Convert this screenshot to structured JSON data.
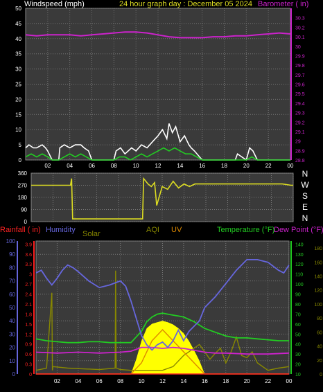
{
  "header": {
    "windspeed_label": "Windspeed (mph)",
    "title": "24 hour graph day : December 05 2024",
    "barometer_label": "Barometer ( in)"
  },
  "legend": {
    "rainfall": "Rainfall ( in)",
    "humidity": "Humidity",
    "solar": "Solar",
    "aqi": "AQI",
    "uv": "UV",
    "temperature": "Temperature (°F)",
    "dewpoint": "Dew Point (°F)"
  },
  "colors": {
    "wind_gust": "#ffffff",
    "wind_avg": "#22cc22",
    "barometer": "#cc22cc",
    "direction": "#dddd22",
    "humidity": "#6666dd",
    "solar": "#ffff00",
    "aqi": "#888800",
    "uv": "#dd8800",
    "temperature": "#22cc22",
    "dewpoint": "#cc22cc",
    "rainfall": "#ff2222"
  },
  "compass": [
    "N",
    "W",
    "S",
    "E",
    "N"
  ],
  "chart_data": [
    {
      "type": "line",
      "name": "wind",
      "ylim": [
        0,
        50
      ],
      "y_ticks": [
        "0",
        "5",
        "10",
        "15",
        "20",
        "25",
        "30",
        "35",
        "40",
        "45",
        "50"
      ],
      "x_ticks": [
        "02",
        "04",
        "06",
        "08",
        "10",
        "12",
        "14",
        "16",
        "18",
        "20",
        "22",
        "00"
      ],
      "series": [
        {
          "name": "gust",
          "x": [
            0,
            0.3,
            0.7,
            1,
            1.5,
            1.8,
            2,
            2.4,
            3,
            3.1,
            3.5,
            4,
            4.5,
            5,
            5.3,
            5.7,
            6,
            7,
            8,
            8.2,
            8.6,
            9,
            9.3,
            9.6,
            10,
            10.5,
            11,
            11.5,
            12,
            12.4,
            12.8,
            13,
            13.3,
            13.6,
            14,
            14.4,
            14.8,
            15,
            15.3,
            16,
            17,
            18,
            19,
            19.2,
            20,
            20.3,
            20.6,
            21,
            22,
            23,
            24
          ],
          "values": [
            4,
            5,
            4,
            4,
            5,
            4,
            3,
            0,
            0,
            4,
            5,
            4,
            5,
            5,
            4,
            3,
            0,
            0,
            0,
            3,
            4,
            2,
            3,
            4,
            3,
            5,
            4,
            6,
            8,
            10,
            7,
            12,
            9,
            11,
            6,
            8,
            5,
            4,
            3,
            0,
            0,
            0,
            0,
            2,
            0,
            4,
            3,
            0,
            0,
            0,
            0
          ]
        },
        {
          "name": "average",
          "x": [
            0,
            0.5,
            1,
            1.5,
            2,
            2.4,
            3,
            3.5,
            4,
            4.5,
            5,
            5.5,
            6,
            7,
            8,
            8.5,
            9,
            9.5,
            10,
            10.5,
            11,
            11.5,
            12,
            12.5,
            13,
            13.5,
            14,
            14.5,
            15,
            15.5,
            16,
            17,
            18,
            19,
            20,
            20.5,
            21,
            22,
            23,
            24
          ],
          "values": [
            1,
            2,
            1,
            2,
            1,
            0,
            0,
            1,
            2,
            1,
            2,
            1,
            0,
            0,
            0,
            1,
            1,
            0,
            1,
            2,
            1,
            2,
            3,
            4,
            3,
            4,
            3,
            2,
            2,
            1,
            0,
            0,
            0,
            0,
            0,
            1,
            0,
            0,
            0,
            0
          ]
        }
      ]
    },
    {
      "type": "line",
      "name": "barometer",
      "ylim": [
        28.8,
        30.4
      ],
      "y_ticks": [
        "28.8",
        "28.9",
        "29",
        "29.1",
        "29.2",
        "29.3",
        "29.4",
        "29.5",
        "29.6",
        "29.7",
        "29.8",
        "29.9",
        "30",
        "30.1",
        "30.2",
        "30.3"
      ],
      "x": [
        0,
        1,
        2,
        3,
        4,
        5,
        6,
        7,
        8,
        9,
        10,
        11,
        12,
        13,
        14,
        15,
        16,
        17,
        18,
        19,
        20,
        21,
        22,
        23,
        24
      ],
      "values": [
        30.12,
        30.11,
        30.12,
        30.12,
        30.12,
        30.11,
        30.12,
        30.13,
        30.14,
        30.15,
        30.15,
        30.14,
        30.12,
        30.1,
        30.09,
        30.09,
        30.09,
        30.1,
        30.1,
        30.11,
        30.11,
        30.12,
        30.13,
        30.14,
        30.13
      ]
    },
    {
      "type": "line",
      "name": "wind_direction",
      "ylim": [
        0,
        360
      ],
      "y_ticks": [
        "0",
        "90",
        "180",
        "270",
        "360"
      ],
      "x": [
        0,
        0.2,
        3.6,
        3.7,
        3.8,
        3.9,
        6,
        8,
        10.2,
        10.3,
        10.5,
        10.7,
        11,
        11.3,
        11.5,
        12,
        12.5,
        13,
        13.5,
        14,
        14.5,
        15,
        16,
        17,
        18,
        19,
        20,
        21,
        22,
        23,
        23.8,
        24
      ],
      "values": [
        270,
        270,
        270,
        320,
        20,
        20,
        20,
        20,
        20,
        320,
        300,
        280,
        260,
        290,
        120,
        260,
        240,
        300,
        250,
        280,
        260,
        280,
        280,
        280,
        280,
        280,
        280,
        280,
        280,
        280,
        270,
        270
      ]
    },
    {
      "type": "line",
      "name": "atmosphere",
      "x_ticks": [
        "02",
        "04",
        "06",
        "08",
        "10",
        "12",
        "14",
        "16",
        "18",
        "20",
        "22",
        "00"
      ],
      "humidity_axis": [
        "0",
        "10",
        "20",
        "30",
        "40",
        "50",
        "60",
        "70",
        "80",
        "90",
        "100"
      ],
      "rainfall_axis": [
        "0",
        "0.3",
        "0.6",
        "0.9",
        "1.2",
        "1.5",
        "1.8",
        "2.1",
        "2.4",
        "2.7",
        "3",
        "3.3",
        "3.6",
        "3.9"
      ],
      "temperature_axis": [
        "10",
        "20",
        "30",
        "40",
        "50",
        "60",
        "70",
        "80",
        "90",
        "100",
        "110",
        "120",
        "130",
        "140"
      ],
      "solar_axis": [
        "0",
        "20",
        "40",
        "60",
        "80",
        "100",
        "120",
        "140",
        "160",
        "180"
      ],
      "series": [
        {
          "name": "Humidity",
          "x": [
            0,
            0.5,
            1,
            1.5,
            2,
            2.5,
            3,
            3.5,
            4,
            5,
            6,
            7,
            8,
            8.5,
            9,
            9.5,
            10,
            10.5,
            11,
            11.5,
            12,
            12.5,
            13,
            13.5,
            14,
            14.5,
            15,
            15.5,
            16,
            17,
            18,
            19,
            20,
            21,
            22,
            23,
            23.5,
            24
          ],
          "values": [
            76,
            78,
            72,
            67,
            72,
            78,
            82,
            80,
            77,
            70,
            65,
            67,
            70,
            66,
            55,
            42,
            29,
            22,
            18,
            22,
            24,
            20,
            25,
            33,
            25,
            32,
            36,
            40,
            50,
            58,
            68,
            78,
            86,
            86,
            84,
            78,
            76,
            82
          ]
        },
        {
          "name": "Temperature",
          "x": [
            0,
            1,
            2,
            3,
            4,
            5,
            6,
            7,
            8,
            9,
            10,
            10.5,
            11,
            11.5,
            12,
            12.5,
            13,
            13.5,
            14,
            15,
            16,
            17,
            18,
            19,
            20,
            21,
            22,
            23,
            24
          ],
          "values": [
            47,
            45,
            44,
            43,
            43,
            44,
            44,
            43,
            43,
            43,
            55,
            65,
            70,
            73,
            74,
            73,
            72,
            71,
            70,
            65,
            58,
            54,
            50,
            48,
            48,
            47,
            46,
            45,
            45
          ]
        },
        {
          "name": "Dew Point",
          "x": [
            0,
            2,
            4,
            6,
            8,
            9,
            10,
            11,
            12,
            13,
            14,
            15,
            16,
            17,
            18,
            20,
            22,
            24
          ],
          "values": [
            33,
            32,
            33,
            32,
            33,
            34,
            38,
            38,
            37,
            38,
            37,
            35,
            33,
            32,
            32,
            31,
            31,
            32
          ]
        },
        {
          "name": "Solar",
          "x": [
            0,
            9,
            9.5,
            10,
            10.5,
            11,
            11.5,
            12,
            12.5,
            13,
            13.5,
            14,
            14.5,
            15,
            15.5,
            16,
            24
          ],
          "values": [
            0,
            0,
            20,
            45,
            62,
            68,
            70,
            72,
            70,
            67,
            62,
            55,
            45,
            32,
            18,
            0,
            0
          ]
        },
        {
          "name": "AQI",
          "x": [
            0,
            1,
            1.5,
            1.55,
            1.6,
            3,
            6,
            7.5,
            7.55,
            7.6,
            8,
            9,
            12,
            13,
            14,
            15,
            15.5,
            16,
            16.5,
            17,
            17.5,
            18,
            18.5,
            19,
            19.5,
            20,
            20.5,
            21,
            22,
            23,
            24
          ],
          "values": [
            5,
            8,
            110,
            5,
            10,
            8,
            6,
            8,
            140,
            8,
            6,
            5,
            5,
            10,
            25,
            35,
            40,
            30,
            20,
            28,
            35,
            15,
            30,
            50,
            25,
            22,
            30,
            15,
            5,
            8,
            10
          ]
        },
        {
          "name": "UV",
          "x": [
            0,
            9,
            10,
            11,
            12,
            13,
            14,
            15,
            16,
            24
          ],
          "values": [
            0,
            0,
            1,
            3,
            4,
            3,
            2,
            1,
            0,
            0
          ]
        },
        {
          "name": "Rainfall",
          "x": [
            0,
            24
          ],
          "values": [
            0,
            0
          ]
        }
      ]
    }
  ]
}
